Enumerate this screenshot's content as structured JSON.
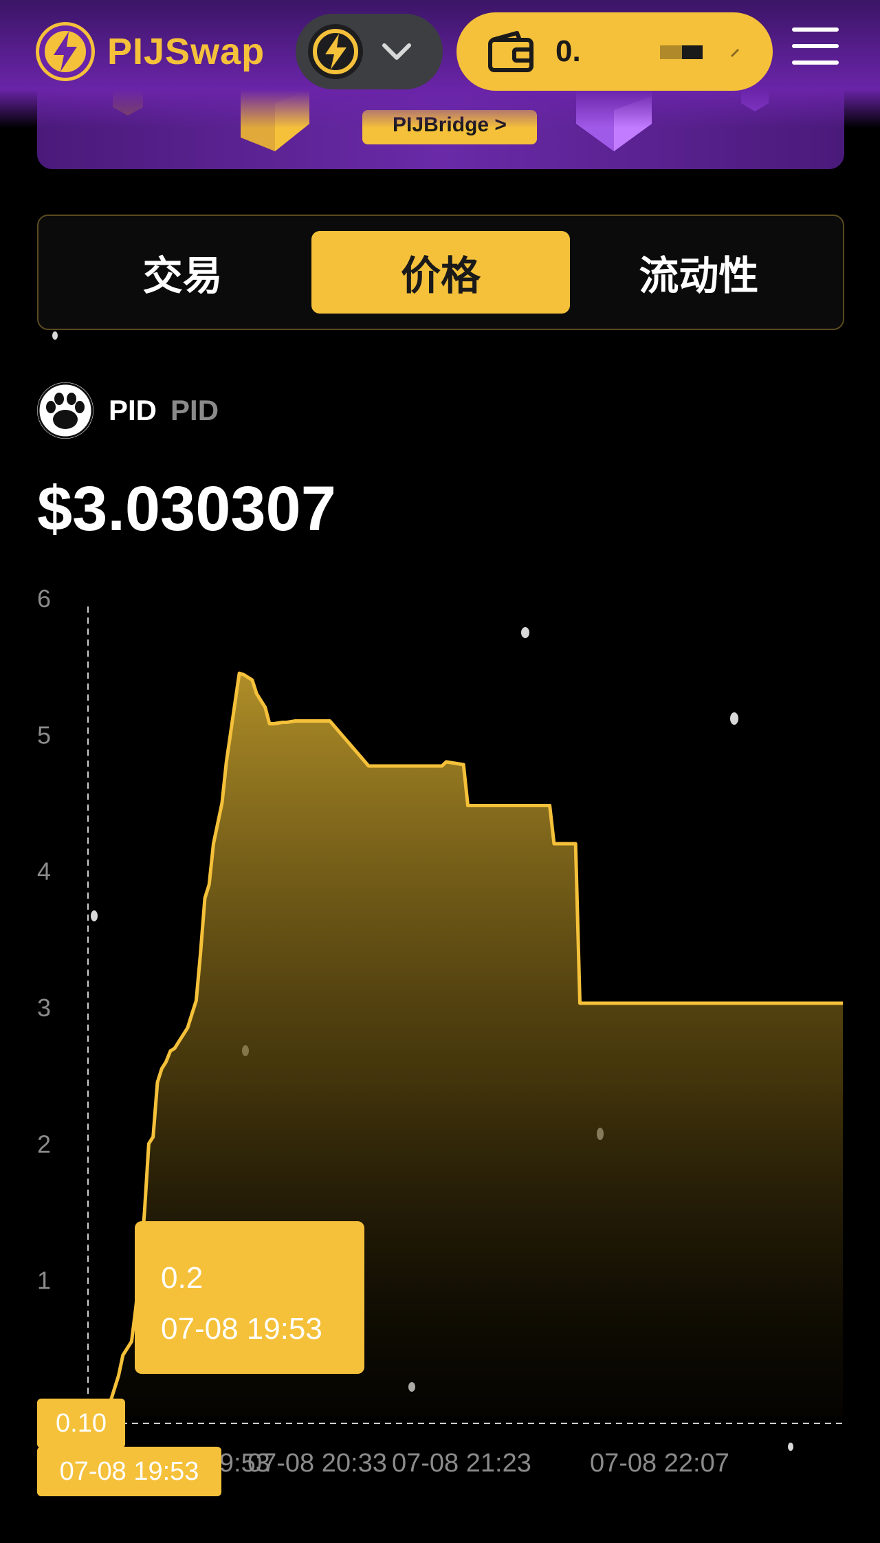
{
  "header": {
    "logo_text": "PIJSwap",
    "wallet_balance": "0."
  },
  "promo": {
    "button_label": "PIJBridge >"
  },
  "tabs": [
    {
      "label": "交易",
      "active": false
    },
    {
      "label": "价格",
      "active": true
    },
    {
      "label": "流动性",
      "active": false
    }
  ],
  "token": {
    "symbol": "PID",
    "name": "PID",
    "price": "$3.030307"
  },
  "tooltip": {
    "value": "0.2",
    "time": "07-08 19:53"
  },
  "crosshair": {
    "y_label": "0.10",
    "x_label": "07-08 19:53"
  },
  "colors": {
    "accent": "#f5c13a",
    "header_purple": "#5a1f92",
    "background": "#000000",
    "axis_text": "#8b8b8b"
  },
  "chart_data": {
    "type": "area",
    "title": "",
    "xlabel": "",
    "ylabel": "",
    "ylim": [
      0,
      6
    ],
    "y_ticks": [
      "6",
      "5",
      "4",
      "3",
      "2",
      "1"
    ],
    "x_ticks": [
      "07-08 19:53",
      "07-08 20:33",
      "07-08 21:23",
      "07-08 22:07"
    ],
    "series": [
      {
        "x_minutes_from_start": [
          0,
          2,
          3,
          5,
          6,
          7,
          8,
          9,
          10,
          11,
          12,
          13,
          14,
          15,
          16,
          17,
          18,
          19,
          20,
          21,
          22,
          23,
          24,
          26,
          27,
          30,
          31,
          33,
          34,
          36,
          37,
          38,
          40,
          41,
          43,
          44,
          46,
          47,
          50,
          51,
          60,
          61,
          77,
          78,
          82,
          83,
          90,
          91,
          102,
          103,
          108,
          109,
          120,
          121,
          170
        ],
        "values": [
          0.1,
          0.3,
          0.45,
          0.55,
          0.8,
          1.1,
          1.5,
          2.0,
          2.05,
          2.45,
          2.55,
          2.6,
          2.68,
          2.7,
          2.75,
          2.8,
          2.85,
          2.95,
          3.05,
          3.4,
          3.8,
          3.9,
          4.2,
          4.5,
          4.8,
          5.45,
          5.44,
          5.4,
          5.3,
          5.2,
          5.08,
          5.08,
          5.09,
          5.09,
          5.1,
          5.1,
          5.1,
          5.1,
          5.1,
          5.1,
          4.77,
          4.77,
          4.77,
          4.8,
          4.78,
          4.48,
          4.48,
          4.48,
          4.48,
          4.2,
          4.2,
          3.03,
          3.03,
          3.03,
          3.03
        ]
      }
    ]
  }
}
